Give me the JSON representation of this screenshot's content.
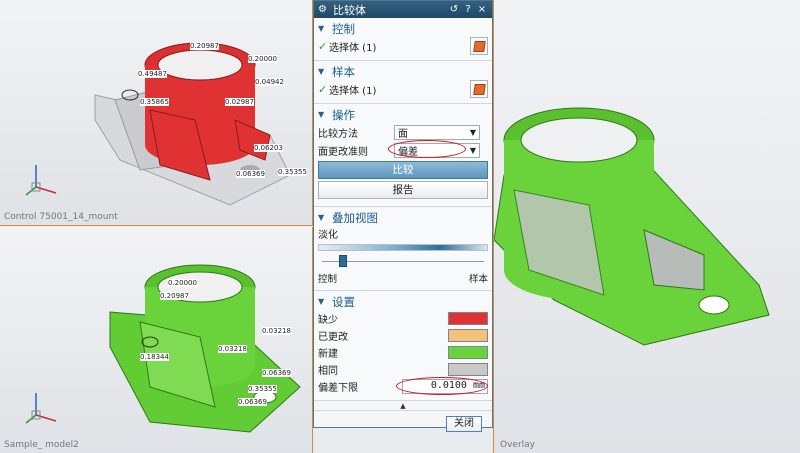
{
  "dialog": {
    "title": "比较体",
    "buttons": {
      "reset_icon": "reset-icon",
      "help_label": "?",
      "close_label": "×"
    },
    "sections": {
      "control": {
        "title": "控制",
        "select_label": "选择体 (1)"
      },
      "sample": {
        "title": "样本",
        "select_label": "选择体 (1)"
      },
      "operation": {
        "title": "操作",
        "method_label": "比较方法",
        "method_value": "面",
        "criterion_label": "面更改准则",
        "criterion_value": "偏差",
        "compare_button": "比较",
        "report_button": "报告"
      },
      "overlay": {
        "title": "叠加视图",
        "fade_label": "淡化",
        "left_end": "控制",
        "right_end": "样本",
        "fade_level": 0.13
      },
      "settings": {
        "title": "设置",
        "colors": [
          {
            "label": "缺少",
            "color": "#e03232"
          },
          {
            "label": "已更改",
            "color": "#f5c07a"
          },
          {
            "label": "新建",
            "color": "#6ad23a"
          },
          {
            "label": "相同",
            "color": "#c8c8c8"
          }
        ],
        "tolerance_label": "偏差下限",
        "tolerance_value": "0.0100 mm"
      },
      "close_button": "关闭"
    }
  },
  "viewports": {
    "control_caption": "Control 75001_14_mount",
    "sample_caption": "Sample_ model2",
    "overlay_caption": "Overlay"
  },
  "annotations": {
    "control": [
      "0.20987",
      "0.20000",
      "0.49487",
      "0.04942",
      "0.35865",
      "0.02987",
      "0.06203",
      "0.06369",
      "0.35355"
    ],
    "sample": [
      "0.20000",
      "0.20987",
      "0.03218",
      "0.18344",
      "0.03218",
      "0.35355",
      "0.06369",
      "0.06369"
    ]
  },
  "colors": {
    "missing": "#e03232",
    "new": "#6ad23a",
    "same": "#d9d9d9",
    "accent": "#1d5d93",
    "titlebar": "#2a5675"
  }
}
